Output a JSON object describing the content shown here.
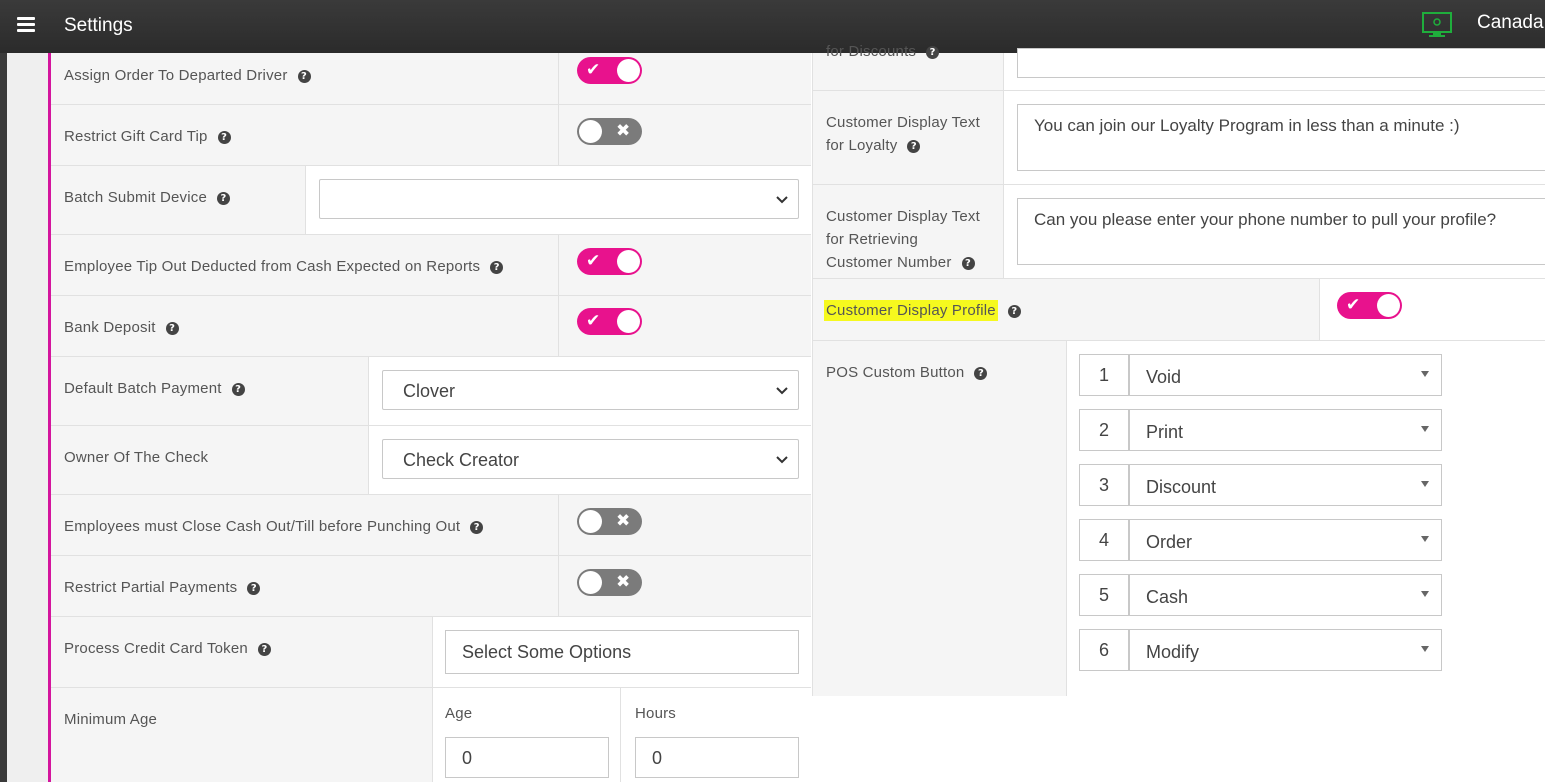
{
  "header": {
    "title": "Settings",
    "region": "Canada"
  },
  "left": {
    "rows": [
      {
        "label": "Assign Order To Departed Driver",
        "toggle": "on"
      },
      {
        "label": "Restrict Gift Card Tip",
        "toggle": "off"
      },
      {
        "label": "Batch Submit Device",
        "select_value": ""
      },
      {
        "label": "Employee Tip Out Deducted from Cash Expected on Reports",
        "toggle": "on"
      },
      {
        "label": "Bank Deposit",
        "toggle": "on"
      },
      {
        "label": "Default Batch Payment",
        "select_value": "Clover"
      },
      {
        "label": "Owner Of The Check",
        "select_value": "Check Creator"
      },
      {
        "label": "Employees must Close Cash Out/Till before Punching Out",
        "toggle": "off"
      },
      {
        "label": "Restrict Partial Payments",
        "toggle": "off"
      },
      {
        "label": "Process Credit Card Token",
        "placeholder": "Select Some Options"
      },
      {
        "label": "Minimum Age",
        "age_label": "Age",
        "age_value": "0",
        "hours_label": "Hours",
        "hours_value": "0"
      }
    ]
  },
  "right": {
    "partial_label": "for Discounts",
    "loyalty": {
      "label_line1": "Customer Display Text",
      "label_line2": "for Loyalty",
      "value": "You can join our Loyalty Program in less than a minute :)"
    },
    "retrieve": {
      "label_line1": "Customer Display Text",
      "label_line2": "for Retrieving",
      "label_line3": "Customer Number",
      "value": "Can you please enter your phone number to pull your profile?"
    },
    "profile": {
      "label": "Customer Display Profile",
      "toggle": "on",
      "highlight_color": "#f6f91e"
    },
    "pos_custom": {
      "label": "POS Custom Button",
      "buttons": [
        {
          "num": "1",
          "value": "Void"
        },
        {
          "num": "2",
          "value": "Print"
        },
        {
          "num": "3",
          "value": "Discount"
        },
        {
          "num": "4",
          "value": "Order"
        },
        {
          "num": "5",
          "value": "Cash"
        },
        {
          "num": "6",
          "value": "Modify"
        }
      ]
    }
  },
  "icons": {
    "on_mark": "✔",
    "off_mark": "✖",
    "help": "?"
  },
  "colors": {
    "toggle_on": "#e8128d",
    "toggle_off": "#7b7b7b",
    "accent_line": "#d4159d",
    "monitor": "#1fae3c"
  }
}
